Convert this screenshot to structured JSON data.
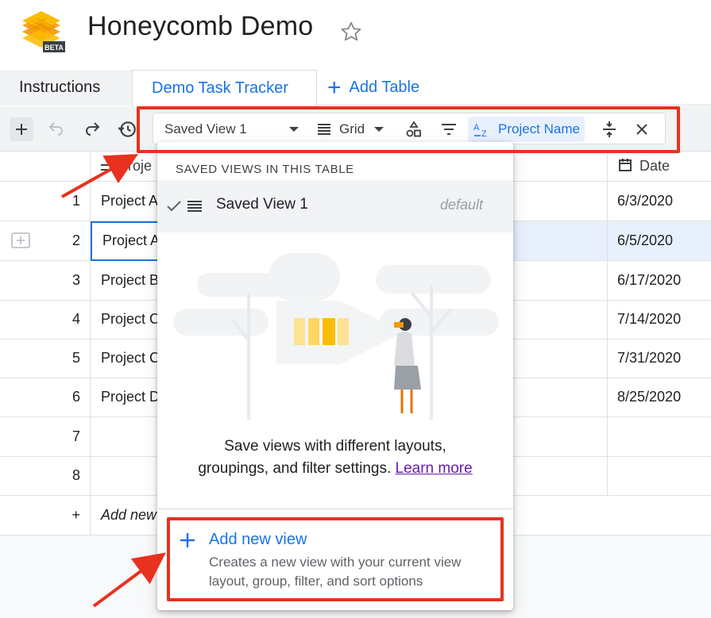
{
  "app": {
    "title": "Honeycomb Demo",
    "logo_badge": "BETA"
  },
  "tabs": [
    {
      "label": "Instructions",
      "active": false
    },
    {
      "label": "Demo Task Tracker",
      "active": true
    }
  ],
  "add_table_label": "Add Table",
  "toolbar": {
    "saved_view": "Saved View 1",
    "layout": "Grid",
    "sort_label": "Project Name"
  },
  "grid": {
    "date_header": "Date",
    "name_header_partial": "Proje",
    "rows": [
      {
        "num": "1",
        "name": "Project A",
        "date": "6/3/2020"
      },
      {
        "num": "2",
        "name": "Project A",
        "date": "6/5/2020"
      },
      {
        "num": "3",
        "name": "Project B",
        "date": "6/17/2020"
      },
      {
        "num": "4",
        "name": "Project C",
        "date": "7/14/2020"
      },
      {
        "num": "5",
        "name": "Project C",
        "date": "7/31/2020"
      },
      {
        "num": "6",
        "name": "Project D",
        "date": "8/25/2020"
      },
      {
        "num": "7",
        "name": "",
        "date": ""
      },
      {
        "num": "8",
        "name": "",
        "date": ""
      }
    ],
    "add_row_symbol": "+",
    "add_row_label": "Add new"
  },
  "dropdown": {
    "heading": "SAVED VIEWS IN THIS TABLE",
    "views": [
      {
        "label": "Saved View 1",
        "tag": "default",
        "checked": true
      }
    ],
    "description_line1": "Save views with different layouts,",
    "description_line2": "groupings, and filter settings.",
    "learn_more": "Learn more",
    "add_view_label": "Add new view",
    "add_view_description": "Creates a new view with your current view layout, group, filter, and sort options"
  },
  "colors": {
    "accent": "#1a73e8",
    "annotation": "#e8311f",
    "selection_bg": "#e8f0fe",
    "toolbar_bg": "#f1f3f4"
  }
}
